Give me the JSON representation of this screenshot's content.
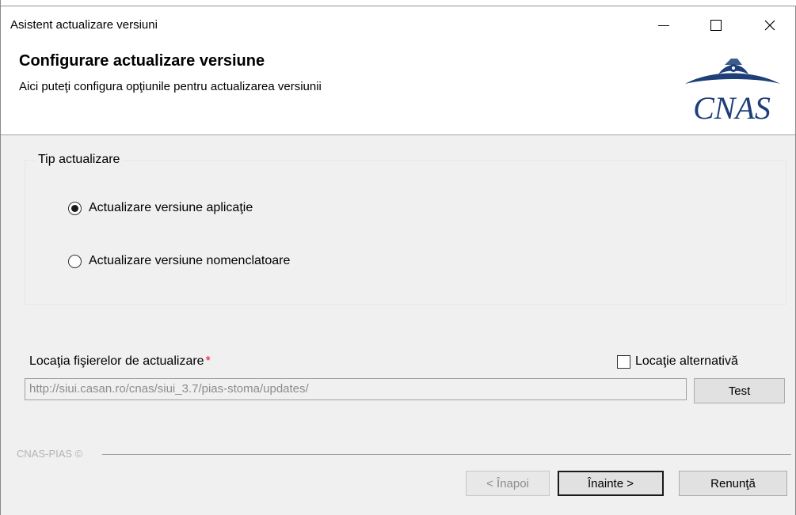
{
  "window": {
    "title": "Asistent actualizare versiuni",
    "minimize_glyph": "—",
    "maximize_glyph": "☐",
    "close_glyph": "✕"
  },
  "header": {
    "title": "Configurare actualizare versiune",
    "subtitle": "Aici puteţi configura opţiunile pentru actualizarea versiunii",
    "logo_text": "CNAS",
    "logo_color": "#1e3f78"
  },
  "update_type": {
    "legend": "Tip actualizare",
    "options": [
      {
        "label": "Actualizare versiune aplicaţie",
        "selected": true
      },
      {
        "label": "Actualizare versiune nomenclatoare",
        "selected": false
      }
    ]
  },
  "location": {
    "label": "Locaţia fişierelor de actualizare",
    "required_marker": "*",
    "url_value": "http://siui.casan.ro/cnas/siui_3.7/pias-stoma/updates/",
    "alternate_label": "Locaţie alternativă",
    "alternate_checked": false,
    "test_button": "Test"
  },
  "footer": {
    "brand": "CNAS-PIAS ©",
    "back_button": "< Înapoi",
    "next_button": "Înainte >",
    "cancel_button": "Renunţă"
  }
}
